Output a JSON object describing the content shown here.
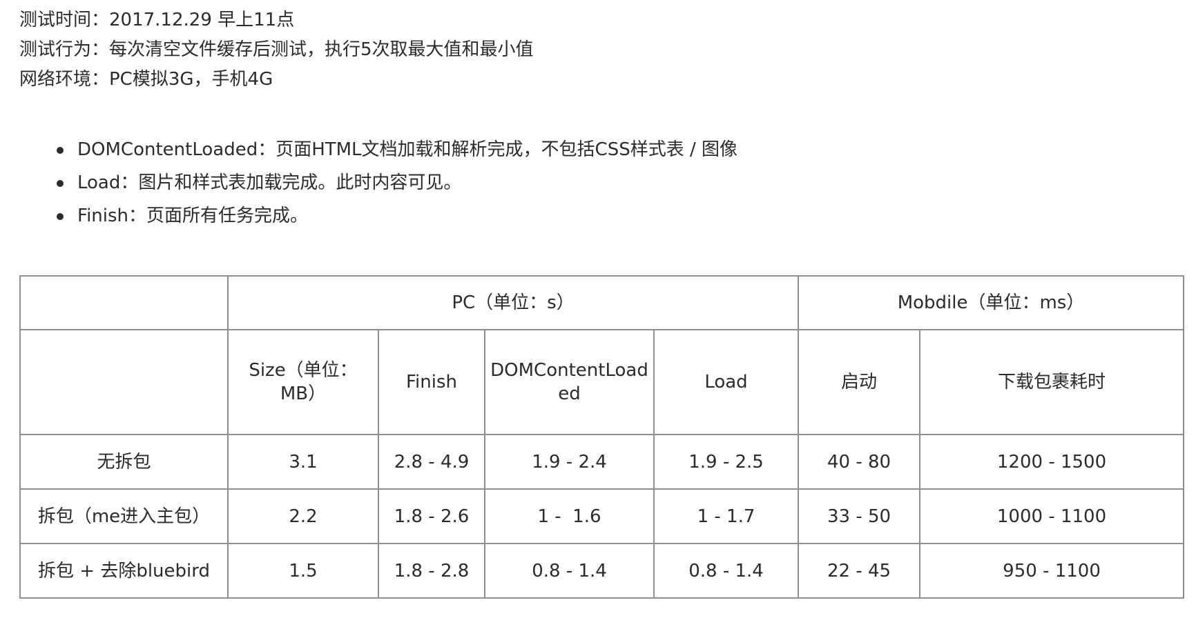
{
  "intro": {
    "line1": "测试时间：2017.12.29 早上11点",
    "line2": "测试行为：每次清空文件缓存后测试，执行5次取最大值和最小值",
    "line3": "网络环境：PC模拟3G，手机4G"
  },
  "bullets": [
    "DOMContentLoaded：页面HTML文档加载和解析完成，不包括CSS样式表 / 图像",
    "Load：图片和样式表加载完成。此时内容可见。",
    "Finish：页面所有任务完成。"
  ],
  "table": {
    "group_header": {
      "empty": "",
      "pc": "PC（单位：s）",
      "mobile": "Mobdile（单位：ms）"
    },
    "col_headers": {
      "empty": "",
      "size": "Size（单位：MB）",
      "finish": "Finish",
      "dcl": "DOMContentLoaded",
      "load": "Load",
      "startup": "启动",
      "download": "下载包裹耗时"
    },
    "rows": [
      {
        "label": "无拆包",
        "size": "3.1",
        "finish": "2.8 - 4.9",
        "dcl": "1.9 - 2.4",
        "load": "1.9 - 2.5",
        "startup": "40 - 80",
        "download": "1200 - 1500"
      },
      {
        "label": "拆包（me进入主包）",
        "size": "2.2",
        "finish": "1.8 - 2.6",
        "dcl": "1 -  1.6",
        "load": "1 - 1.7",
        "startup": "33 - 50",
        "download": "1000 - 1100"
      },
      {
        "label": "拆包 + 去除bluebird",
        "size": "1.5",
        "finish": "1.8 - 2.8",
        "dcl": "0.8 - 1.4",
        "load": "0.8 - 1.4",
        "startup": "22 - 45",
        "download": "950 - 1100"
      }
    ]
  }
}
